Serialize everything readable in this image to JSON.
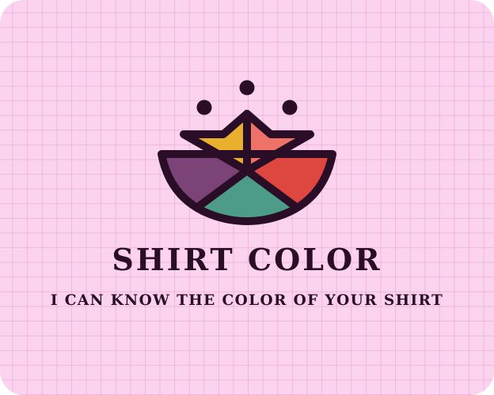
{
  "brand": {
    "title": "SHIRT COLOR",
    "tagline": "I CAN KNOW THE COLOR OF YOUR SHIRT"
  },
  "colors": {
    "background": "#fcd3ee",
    "grid": "#e096cd",
    "ink": "#2a0d27",
    "petal_yellow": "#e8b02c",
    "petal_salmon": "#ef7268",
    "petal_purple": "#7c4377",
    "petal_red": "#de4740",
    "petal_teal": "#4d9c8a"
  },
  "logo": {
    "icon": "lotus-icon"
  }
}
